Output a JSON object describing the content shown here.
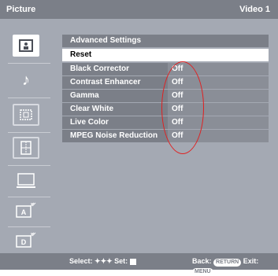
{
  "header": {
    "title": "Picture",
    "input": "Video 1"
  },
  "sidebar": {
    "items": [
      {
        "name": "picture-icon",
        "glyph": "▣"
      },
      {
        "name": "music-note-icon",
        "glyph": "♪"
      },
      {
        "name": "screen-icon",
        "glyph": "⊞"
      },
      {
        "name": "setup-icon",
        "glyph": "⊟"
      },
      {
        "name": "monitor-icon",
        "glyph": "▭"
      },
      {
        "name": "analog-input-icon",
        "glyph": "A"
      },
      {
        "name": "digital-input-icon",
        "glyph": "D"
      }
    ]
  },
  "menu": {
    "advanced_settings": "Advanced Settings",
    "reset": "Reset",
    "items": [
      {
        "label": "Black Corrector",
        "value": "Off"
      },
      {
        "label": "Contrast Enhancer",
        "value": "Off"
      },
      {
        "label": "Gamma",
        "value": "Off"
      },
      {
        "label": "Clear White",
        "value": "Off"
      },
      {
        "label": "Live Color",
        "value": "Off"
      },
      {
        "label": "MPEG Noise Reduction",
        "value": "Off"
      }
    ]
  },
  "footer": {
    "select_label": "Select:",
    "select_arrows": "✦✦✦",
    "set_label": "Set:",
    "back_label": "Back:",
    "return_btn": "RETURN",
    "exit_label": "Exit:",
    "menu_btn": "MENU"
  },
  "colors": {
    "annotation": "#e02020",
    "panel": "#7b7f88",
    "background": "#a4a9b3"
  }
}
